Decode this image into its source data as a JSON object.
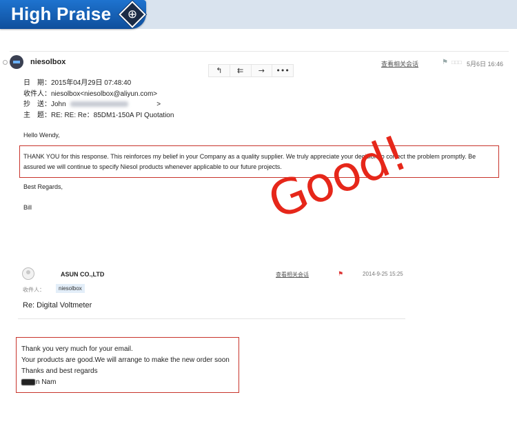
{
  "banner": {
    "title": "High Praise",
    "icon": "globe-icon"
  },
  "email1": {
    "sender": "niesolbox",
    "thread_link": "查看相关会话",
    "tag": "□□□",
    "time": "5月6日 16:46",
    "toolbar": {
      "reply": "↰",
      "reply_all": "⇇",
      "forward": "→",
      "more": "•••"
    },
    "meta": {
      "date_label": "日　期：",
      "date_value": "2015年04月29日 07:48:40",
      "to_label": "收件人：",
      "to_value": "niesolbox<niesolbox@aliyun.com>",
      "cc_label": "抄　送：",
      "cc_value": "John",
      "cc_end": ">",
      "subject_label": "主　题：",
      "subject_value": "RE: RE: Re：85DM1-150A PI Quotation"
    },
    "greeting": "Hello Wendy,",
    "highlight": "THANK YOU for this response. This reinforces my belief in your Company as a quality supplier. We truly appreciate your decision to correct the problem promptly. Be assured we will continue to specify Niesol products whenever applicable to our future projects.",
    "closing": "Best Regards,",
    "signature": "Bill"
  },
  "stamp": "Good!",
  "email2": {
    "sender": "ASUN CO.,LTD",
    "thread_link": "查看相关会话",
    "time": "2014-9-25 15:25",
    "to_label": "收件人：",
    "to_chip": "niesolbox",
    "subject": "Re: Digital Voltmeter",
    "lines": [
      "Thank you very much for your email.",
      "Your products are good.We will arrange to make the new order soon",
      "Thanks and best regards"
    ],
    "signature_tail": "n Nam"
  },
  "colors": {
    "banner_blue": "#1565c0",
    "highlight_red": "#c8332a",
    "stamp_red": "#e6271a"
  }
}
